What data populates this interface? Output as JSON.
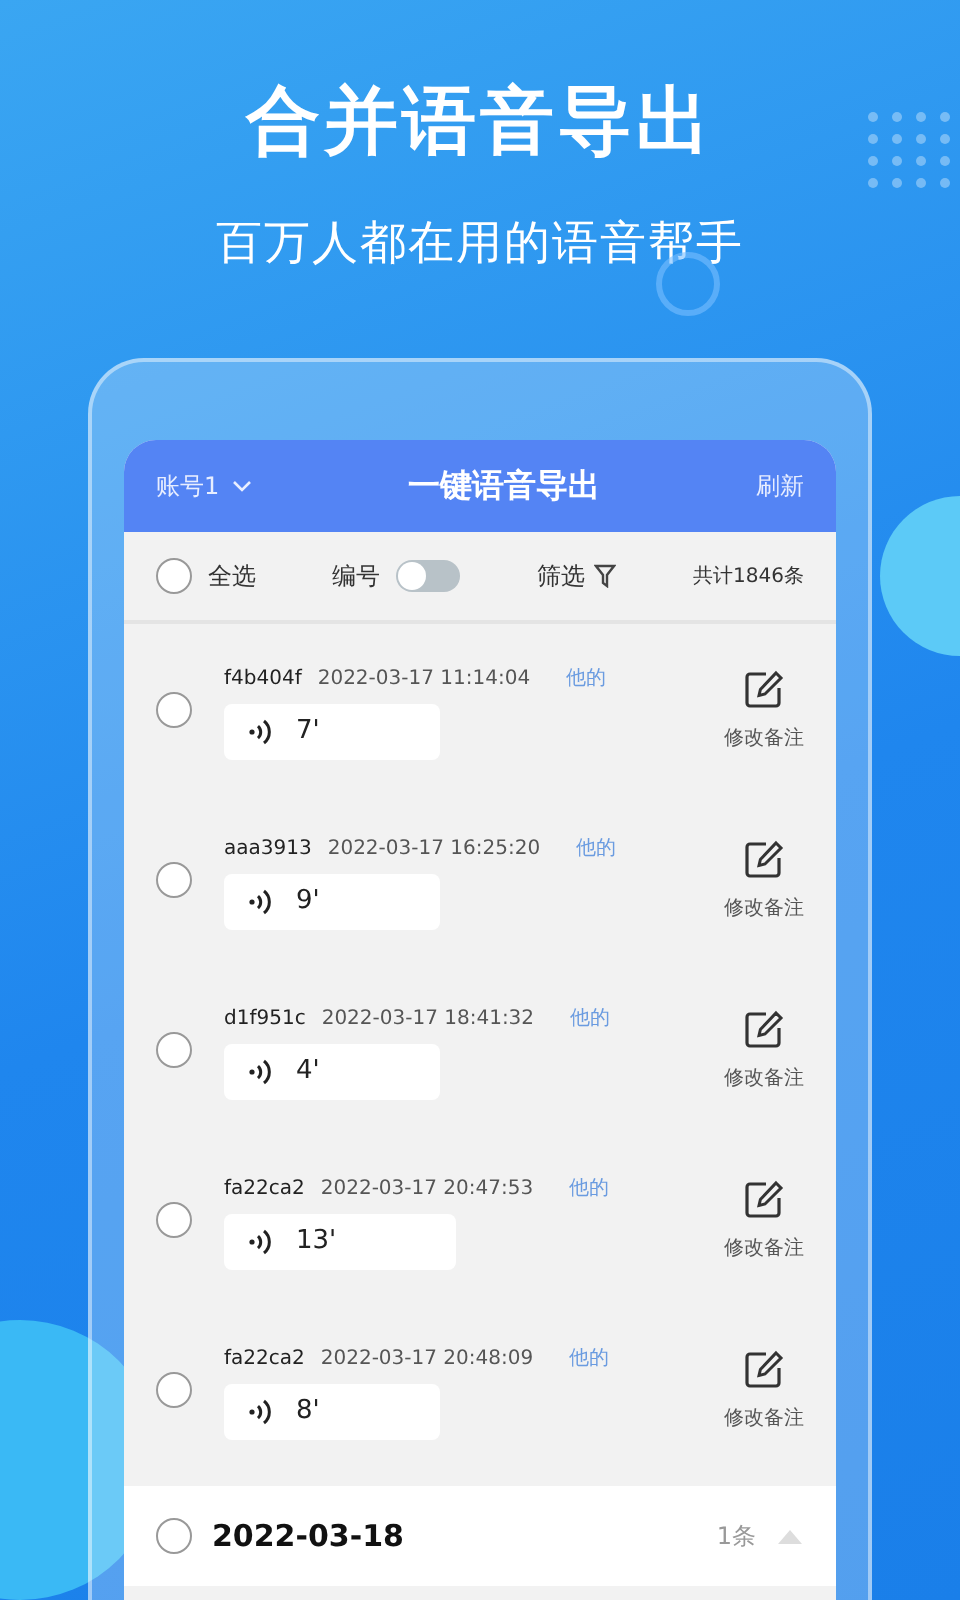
{
  "banner": {
    "title": "合并语音导出",
    "subtitle": "百万人都在用的语音帮手"
  },
  "header": {
    "account": "账号1",
    "title": "一键语音导出",
    "refresh": "刷新"
  },
  "toolbar": {
    "select_all": {
      "label": "全选",
      "checked": false
    },
    "numbering": {
      "label": "编号",
      "on": false
    },
    "filter": "筛选",
    "total": "共计1846条"
  },
  "messages": [
    {
      "sender": "f4b404f",
      "time": "2022-03-17 11:14:04",
      "tag": "他的",
      "duration": "7'",
      "checked": false,
      "action": "修改备注"
    },
    {
      "sender": "aaa3913",
      "time": "2022-03-17 16:25:20",
      "tag": "他的",
      "duration": "9'",
      "checked": false,
      "action": "修改备注"
    },
    {
      "sender": "d1f951c",
      "time": "2022-03-17 18:41:32",
      "tag": "他的",
      "duration": "4'",
      "checked": false,
      "action": "修改备注"
    },
    {
      "sender": "fa22ca2",
      "time": "2022-03-17 20:47:53",
      "tag": "他的",
      "duration": "13'",
      "checked": false,
      "action": "修改备注"
    },
    {
      "sender": "fa22ca2",
      "time": "2022-03-17 20:48:09",
      "tag": "他的",
      "duration": "8'",
      "checked": false,
      "action": "修改备注"
    }
  ],
  "date_group": {
    "date": "2022-03-18",
    "count": "1条",
    "checked": false,
    "expanded": true
  }
}
